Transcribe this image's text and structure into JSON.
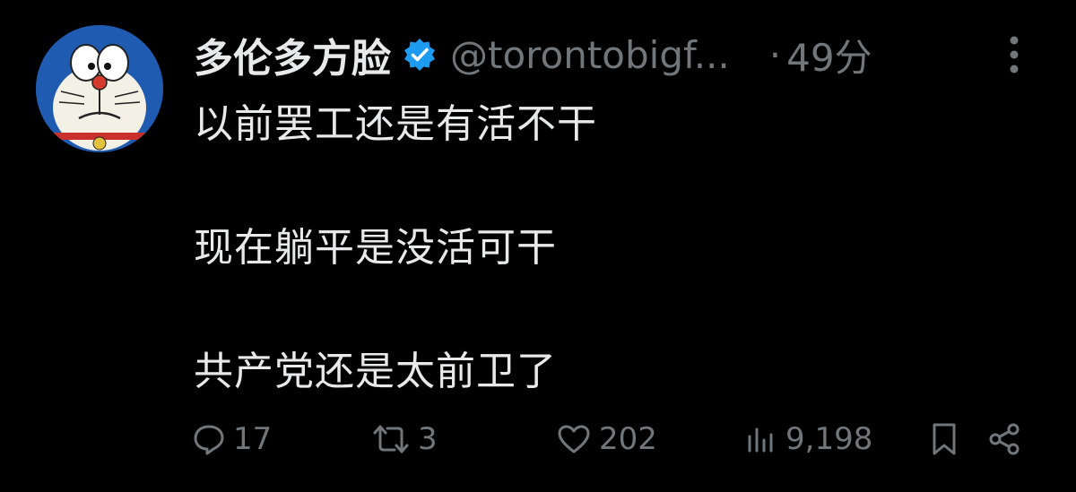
{
  "tweet": {
    "display_name": "多伦多方脸",
    "handle": "@torontobigf...",
    "dot": "·",
    "time": "49分",
    "lines": [
      "以前罢工还是有活不干",
      "现在躺平是没活可干",
      "共产党还是太前卫了"
    ]
  },
  "actions": {
    "replies": "17",
    "retweets": "3",
    "likes": "202",
    "views": "9,198"
  },
  "colors": {
    "background": "#000000",
    "text": "#e7e9ea",
    "muted": "#71767b",
    "verified": "#1d9bf0"
  },
  "icons": {
    "avatar": "doraemon-avatar",
    "verified": "verified-badge-icon",
    "more": "more-vertical-icon",
    "reply": "reply-icon",
    "retweet": "retweet-icon",
    "like": "heart-icon",
    "views": "views-icon",
    "bookmark": "bookmark-icon",
    "share": "share-icon"
  }
}
